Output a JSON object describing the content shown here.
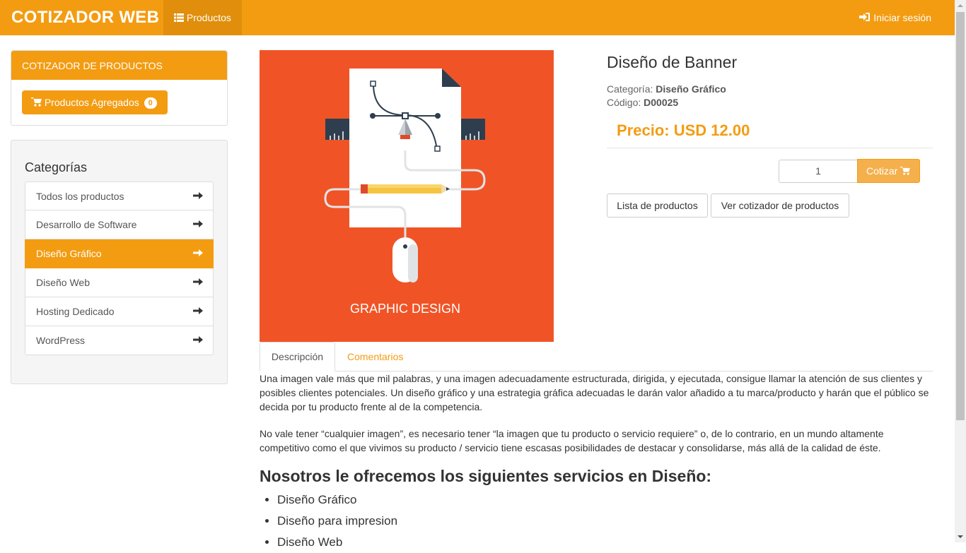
{
  "navbar": {
    "brand": "COTIZADOR WEB",
    "products_label": "Productos",
    "login_label": "Iniciar sesión",
    "accent": "#f39c12"
  },
  "cart_panel": {
    "heading": "COTIZADOR DE PRODUCTOS",
    "button_label": "Productos Agregados",
    "count": "0"
  },
  "categories": {
    "title": "Categorías",
    "items": [
      {
        "label": "Todos los productos",
        "active": false
      },
      {
        "label": "Desarrollo de Software",
        "active": false
      },
      {
        "label": "Diseño Gráfico",
        "active": true
      },
      {
        "label": "Diseño Web",
        "active": false
      },
      {
        "label": "Hosting Dedicado",
        "active": false
      },
      {
        "label": "WordPress",
        "active": false
      }
    ]
  },
  "product": {
    "image_caption": "GRAPHIC DESIGN",
    "title": "Diseño de Banner",
    "category_label": "Categoría:",
    "category_value": "Diseño Gráfico",
    "code_label": "Código:",
    "code_value": "D00025",
    "price": "Precio: USD 12.00",
    "quantity": "1",
    "quote_button": "Cotizar",
    "list_button": "Lista de productos",
    "view_quote_button": "Ver cotizador de productos"
  },
  "tabs": {
    "description": "Descripción",
    "comments": "Comentarios"
  },
  "description": {
    "paragraph1": "Una imagen vale más que mil palabras, y una imagen adecuadamente estructurada, dirigida, y ejecutada, consigue llamar la atención de sus clientes y posibles clientes potenciales. Un diseño gráfico y una estrategia gráfica adecuadas le darán valor añadido a tu marca/producto y harán que el público se decida por tu producto frente al de la competencia.",
    "paragraph2": "No vale tener “cualquier imagen”, es necesario tener “la imagen que tu producto o servicio requiere” o, de lo contrario, en un mundo altamente competitivo como el que vivimos su producto / servicio tiene escasas posibilidades de destacar y consolidarse, más allá de la calidad de éste.",
    "heading": "Nosotros le ofrecemos los siguientes servicios en Diseño:",
    "services": [
      "Diseño Gráfico",
      "Diseño para impresion",
      "Diseño Web"
    ]
  }
}
